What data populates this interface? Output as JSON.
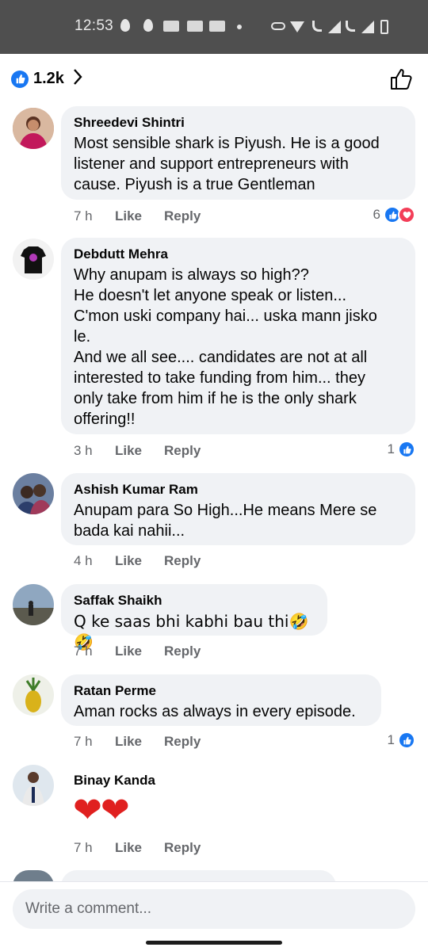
{
  "status_bar": {
    "time": "12:53"
  },
  "header": {
    "reaction_count": "1.2k",
    "chevron": "›"
  },
  "comments": [
    {
      "author": "Shreedevi Shintri",
      "text": "Most sensible shark is Piyush. He is a good\nlistener and support entrepreneurs with\ncause. Piyush is a true Gentleman",
      "time": "7 h",
      "like": "Like",
      "reply": "Reply",
      "reactions": "6"
    },
    {
      "author": "Debdutt Mehra",
      "text": "Why anupam is always so high??\nHe doesn't let anyone speak or listen...\nC'mon uski company hai... uska mann jisko\nle.\nAnd we all see.... candidates are not at all\ninterested to take funding from him... they\nonly take  from him if he is the only shark\noffering!!",
      "time": "3 h",
      "like": "Like",
      "reply": "Reply",
      "reactions": "1"
    },
    {
      "author": "Ashish Kumar Ram",
      "text": "Anupam para So High...He means Mere se\nbada kai nahii...",
      "time": "4 h",
      "like": "Like",
      "reply": "Reply"
    },
    {
      "author": "Saffak Shaikh",
      "text": "Q ke saas bhi kabhi bau thi🤣🤣",
      "time": "7 h",
      "like": "Like",
      "reply": "Reply"
    },
    {
      "author": "Ratan Perme",
      "text": "Aman rocks as always in every episode.",
      "time": "7 h",
      "like": "Like",
      "reply": "Reply",
      "reactions": "1"
    },
    {
      "author": "Binay Kanda",
      "text": "❤❤",
      "time": "7 h",
      "like": "Like",
      "reply": "Reply"
    }
  ],
  "composer": {
    "placeholder": "Write a comment..."
  },
  "colors": {
    "brand_blue": "#1877f2",
    "love_red": "#f33e58",
    "bubble": "#f0f2f5",
    "meta_gray": "#65676b"
  },
  "icons": [
    "like-icon",
    "love-icon",
    "chevron-right-icon",
    "thumbs-up-outline-icon"
  ]
}
